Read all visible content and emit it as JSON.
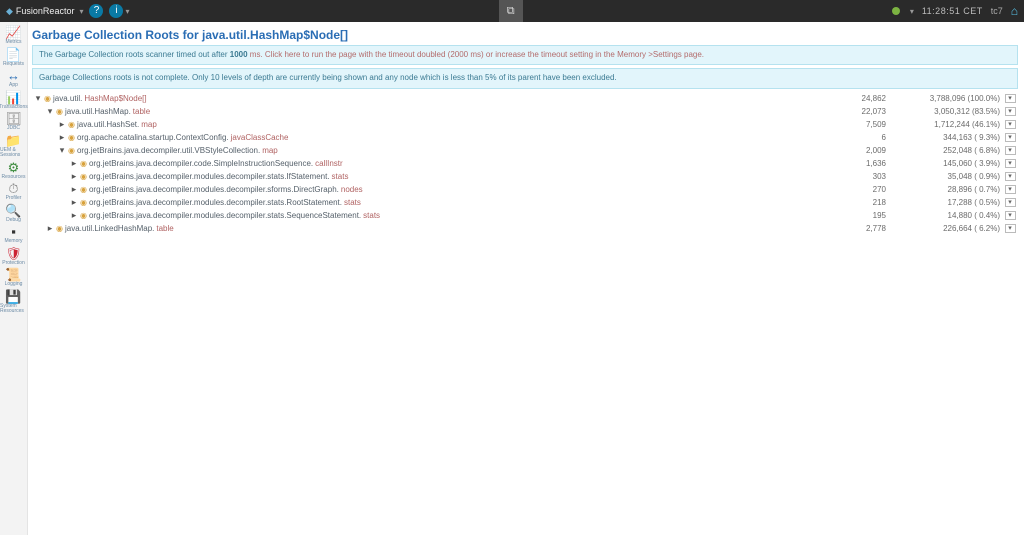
{
  "header": {
    "brand": "FusionReactor",
    "clock": "11:28:51 CET",
    "server": "tc7"
  },
  "sidebar": [
    {
      "icon": "📈",
      "cls": "red",
      "label": "Metrics"
    },
    {
      "icon": "📄",
      "cls": "gray",
      "label": "Requests"
    },
    {
      "icon": "↔",
      "cls": "blue",
      "label": "App"
    },
    {
      "icon": "📊",
      "cls": "orange",
      "label": "Transactions"
    },
    {
      "icon": "🗄",
      "cls": "gray",
      "label": "JDBC"
    },
    {
      "icon": "📁",
      "cls": "orange",
      "label": "UEM & Sessions"
    },
    {
      "icon": "⚙",
      "cls": "green",
      "label": "Resources"
    },
    {
      "icon": "⏱",
      "cls": "gray",
      "label": "Profiler"
    },
    {
      "icon": "🔍",
      "cls": "gray",
      "label": "Debug"
    },
    {
      "icon": "▪",
      "cls": "dark",
      "label": "Memory"
    },
    {
      "icon": "🛡",
      "cls": "red",
      "label": "Protection"
    },
    {
      "icon": "📜",
      "cls": "orange",
      "label": "Logging"
    },
    {
      "icon": "💾",
      "cls": "gray",
      "label": "System Resources"
    }
  ],
  "page": {
    "title": "Garbage Collection Roots for java.util.HashMap$Node[]",
    "info1a": "The Garbage Collection roots scanner timed out after ",
    "info1b": "1000",
    "info1c": " ms. Click here to run the page with the timeout doubled (2000 ms) or increase the timeout setting in the Memory >Settings page.",
    "info2": "Garbage Collections roots is not complete. Only 10 levels of depth are currently being shown and any node which is less than 5% of its parent have been excluded."
  },
  "tree": [
    {
      "ind": 0,
      "exp": "▾",
      "pkg": "java.util.",
      "cls": "HashMap$Node[]",
      "num": "24,862",
      "sz": "3,788,096 (100.0%)"
    },
    {
      "ind": 1,
      "exp": "▾",
      "pkg": "java.util.HashMap.",
      "cls": "table",
      "num": "22,073",
      "sz": "3,050,312 (83.5%)"
    },
    {
      "ind": 2,
      "exp": "▸",
      "pkg": "java.util.HashSet.",
      "cls": "map",
      "num": "7,509",
      "sz": "1,712,244 (46.1%)"
    },
    {
      "ind": 2,
      "exp": "▸",
      "pkg": "org.apache.catalina.startup.ContextConfig.",
      "cls": "javaClassCache",
      "num": "6",
      "sz": "344,163 ( 9.3%)"
    },
    {
      "ind": 2,
      "exp": "▾",
      "pkg": "org.jetBrains.java.decompiler.util.VBStyleCollection.",
      "cls": "map",
      "num": "2,009",
      "sz": "252,048 ( 6.8%)"
    },
    {
      "ind": 3,
      "exp": "▸",
      "pkg": "org.jetBrains.java.decompiler.code.SimpleInstructionSequence.",
      "cls": "callInstr",
      "num": "1,636",
      "sz": "145,060 ( 3.9%)"
    },
    {
      "ind": 3,
      "exp": "▸",
      "pkg": "org.jetBrains.java.decompiler.modules.decompiler.stats.IfStatement.",
      "cls": "stats",
      "num": "303",
      "sz": "35,048 ( 0.9%)"
    },
    {
      "ind": 3,
      "exp": "▸",
      "pkg": "org.jetBrains.java.decompiler.modules.decompiler.sforms.DirectGraph.",
      "cls": "nodes",
      "num": "270",
      "sz": "28,896 ( 0.7%)"
    },
    {
      "ind": 3,
      "exp": "▸",
      "pkg": "org.jetBrains.java.decompiler.modules.decompiler.stats.RootStatement.",
      "cls": "stats",
      "num": "218",
      "sz": "17,288 ( 0.5%)"
    },
    {
      "ind": 3,
      "exp": "▸",
      "pkg": "org.jetBrains.java.decompiler.modules.decompiler.stats.SequenceStatement.",
      "cls": "stats",
      "num": "195",
      "sz": "14,880 ( 0.4%)"
    },
    {
      "ind": 1,
      "exp": "▸",
      "pkg": "java.util.LinkedHashMap.",
      "cls": "table",
      "num": "2,778",
      "sz": "226,664 ( 6.2%)"
    }
  ]
}
